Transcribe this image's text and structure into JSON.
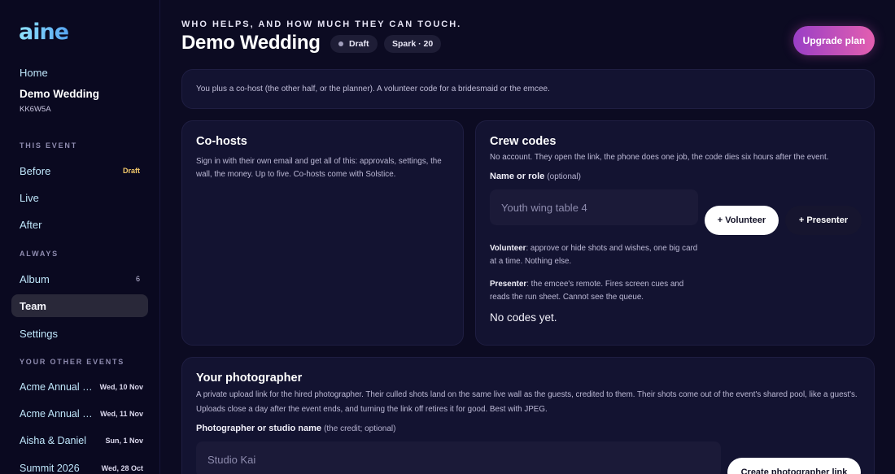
{
  "sidebar": {
    "logo": "aine",
    "home": "Home",
    "current_event": {
      "name": "Demo Wedding",
      "code": "KK6W5A"
    },
    "this_event_label": "THIS EVENT",
    "before": {
      "label": "Before",
      "badge": "Draft"
    },
    "live": "Live",
    "after": "After",
    "always_label": "ALWAYS",
    "album": {
      "label": "Album",
      "count": "6"
    },
    "team": "Team",
    "settings": "Settings",
    "other_events_label": "YOUR OTHER EVENTS",
    "other_events": [
      {
        "name": "Acme Annual Gala",
        "date": "Wed, 10 Nov"
      },
      {
        "name": "Acme Annual Summit",
        "date": "Wed, 11 Nov"
      },
      {
        "name": "Aisha & Daniel",
        "date": "Sun, 1 Nov"
      },
      {
        "name": "Summit 2026",
        "date": "Wed, 28 Oct"
      }
    ]
  },
  "header": {
    "kicker": "WHO HELPS, AND HOW MUCH THEY CAN TOUCH.",
    "title": "Demo Wedding",
    "status_pill": "Draft",
    "plan_pill": "Spark · 20",
    "upgrade_button": "Upgrade plan"
  },
  "intro": "You plus a co-host (the other half, or the planner). A volunteer code for a bridesmaid or the emcee.",
  "cohosts": {
    "title": "Co-hosts",
    "description": "Sign in with their own email and get all of this: approvals, settings, the wall, the money. Up to five. Co-hosts come with Solstice."
  },
  "crew": {
    "title": "Crew codes",
    "description": "No account. They open the link, the phone does one job, the code dies six hours after the event.",
    "field_label": "Name or role",
    "field_optional": "(optional)",
    "placeholder": "Youth wing table 4",
    "volunteer_button": "+ Volunteer",
    "presenter_button": "+ Presenter",
    "volunteer_term": "Volunteer",
    "volunteer_info": ": approve or hide shots and wishes, one big card at a time. Nothing else.",
    "presenter_term": "Presenter",
    "presenter_info": ": the emcee's remote. Fires screen cues and reads the run sheet. Cannot see the queue.",
    "empty": "No codes yet."
  },
  "photographer": {
    "title": "Your photographer",
    "description": "A private upload link for the hired photographer. Their culled shots land on the same live wall as the guests, credited to them. Their shots come out of the event's shared pool, like a guest's. Uploads close a day after the event ends, and turning the link off retires it for good. Best with JPEG.",
    "field_label": "Photographer or studio name",
    "field_optional": "(the credit; optional)",
    "placeholder": "Studio Kai",
    "create_button": "Create photographer link"
  }
}
